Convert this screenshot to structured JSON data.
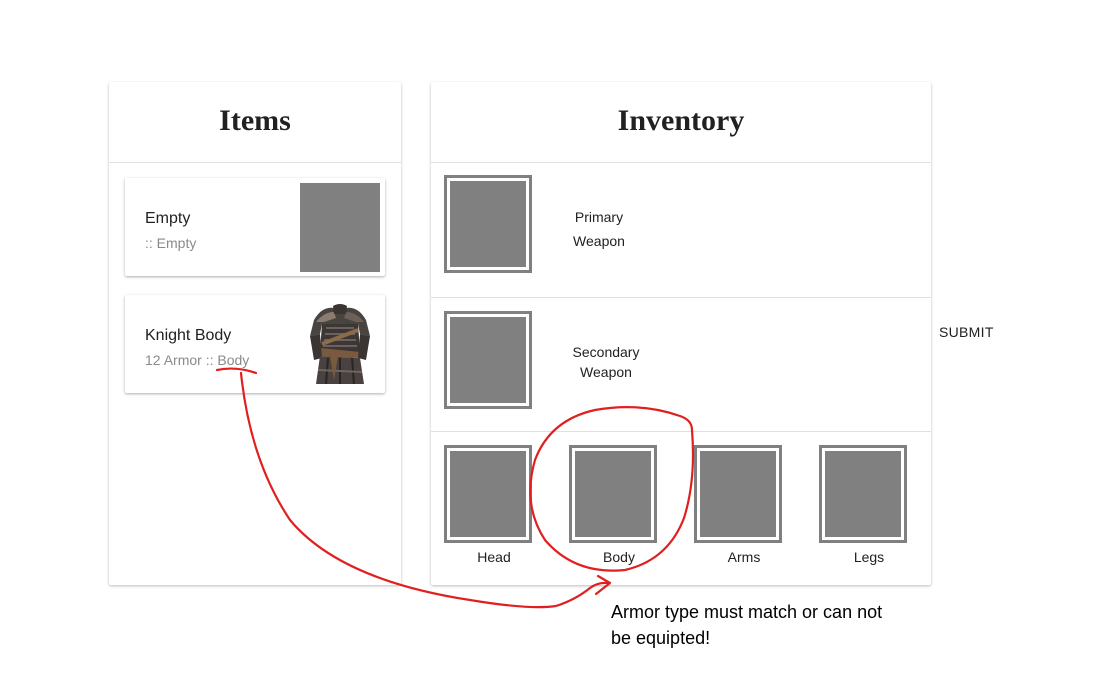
{
  "items_panel": {
    "title": "Items",
    "items": [
      {
        "name": "Empty",
        "stats": ":: Empty",
        "thumbnail": "empty-gray-thumbnail"
      },
      {
        "name": "Knight Body",
        "stats_prefix": "12 Armor :: ",
        "type": "Body",
        "thumbnail": "knight-body-armor-image"
      }
    ]
  },
  "inventory_panel": {
    "title": "Inventory",
    "primary_weapon": {
      "line1": "Primary",
      "line2": "Weapon"
    },
    "secondary_weapon": {
      "line1": "Secondary",
      "line2": "Weapon"
    },
    "armor_slots": [
      {
        "label": "Head"
      },
      {
        "label": "Body"
      },
      {
        "label": "Arms"
      },
      {
        "label": "Legs"
      }
    ]
  },
  "submit_label": "SUBMIT",
  "annotation": {
    "note": "Armor type must match or can not be equipted!",
    "color": "#e02020"
  },
  "colors": {
    "slot_gray": "#808080",
    "secondary_text": "#8a8a8a",
    "divider": "#e0e0e0"
  }
}
